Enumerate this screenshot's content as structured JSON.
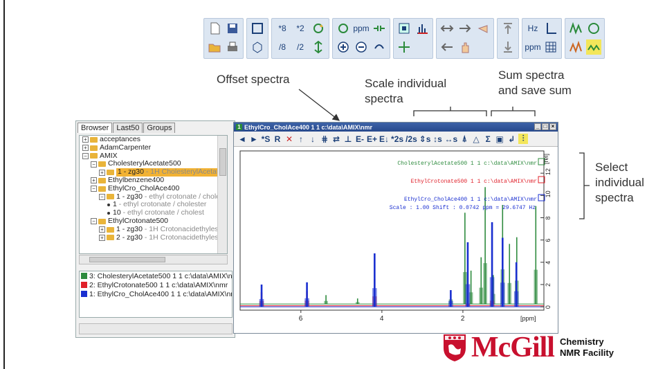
{
  "top_toolbar": {
    "groups": [
      {
        "buttons": [
          "new-file-icon",
          "open-folder-icon",
          "save-icon",
          "print-icon"
        ]
      },
      {
        "buttons": [
          "full-view-icon",
          "cube-icon"
        ]
      },
      {
        "buttons": [
          "*8",
          "/8",
          "*2",
          "/2",
          "rotate-icon",
          "center-icon"
        ]
      },
      {
        "buttons": [
          "cycle-icon",
          "zoom-in-icon",
          "ppm",
          "zoom-out-icon",
          "shift-icon",
          "refresh-icon"
        ]
      },
      {
        "buttons": [
          "window-icon",
          "expand-icon",
          "peak-pick-icon"
        ]
      },
      {
        "buttons": [
          "left-right-icon",
          "left-icon",
          "right-icon",
          "hand-icon",
          "hand2-icon"
        ]
      },
      {
        "buttons": [
          "top-icon",
          "down-icon"
        ]
      },
      {
        "buttons": [
          "Hz",
          "ppm",
          "axis-icon",
          "grid-icon"
        ]
      },
      {
        "buttons": [
          "multi-icon",
          "overlay-icon",
          "cross-icon",
          "stack-icon"
        ]
      }
    ]
  },
  "annotations": {
    "offset": "Offset spectra",
    "scale_line1": "Scale individual",
    "scale_line2": "spectra",
    "sum_line1": "Sum spectra",
    "sum_line2": "and save sum",
    "select_line1": "Select",
    "select_line2": "individual",
    "select_line3": "spectra"
  },
  "left_panel": {
    "tabs": [
      "Browser",
      "Last50",
      "Groups"
    ],
    "tree": [
      {
        "level": 0,
        "type": "folder",
        "label": "acceptances"
      },
      {
        "level": 0,
        "type": "folder",
        "label": "AdamCarpenter"
      },
      {
        "level": 0,
        "type": "folder",
        "label": "AMIX",
        "expanded": true
      },
      {
        "level": 1,
        "type": "folder",
        "label": "CholesterylAcetate500",
        "expanded": true
      },
      {
        "level": 2,
        "type": "folder",
        "label": "1 - zg30",
        "detail": " - 1H CholesterylAcetat",
        "selected": true
      },
      {
        "level": 1,
        "type": "folder",
        "label": "Ethylbenzene400"
      },
      {
        "level": 1,
        "type": "folder",
        "label": "EthylCro_CholAce400",
        "expanded": true
      },
      {
        "level": 2,
        "type": "folder",
        "label": "1 - zg30",
        "detail": " - ethyl crotonate / chole",
        "expanded": true
      },
      {
        "level": 3,
        "type": "dot",
        "label": "1",
        "detail": " - ethyl crotonate / cholester"
      },
      {
        "level": 3,
        "type": "dot",
        "label": "10",
        "detail": " - ethyl crotonate / cholest"
      },
      {
        "level": 1,
        "type": "folder",
        "label": "EthylCrotonate500",
        "expanded": true
      },
      {
        "level": 2,
        "type": "folder",
        "label": "1 - zg30",
        "detail": " - 1H Crotonacidethylest"
      },
      {
        "level": 2,
        "type": "folder",
        "label": "2 - zg30",
        "detail": " - 1H Crotonacidethylest"
      }
    ],
    "spectra_list": [
      {
        "label": "3: CholesterylAcetate500  1  1  c:\\data\\AMIX\\nm",
        "color": "#2e8b3e"
      },
      {
        "label": "2: EthylCrotonate500  1  1  c:\\data\\AMIX\\nmr",
        "color": "#e0202a"
      },
      {
        "label": "1: EthylCro_CholAce400  1  1  c:\\data\\AMIX\\nmr",
        "color": "#1a2fd0"
      }
    ]
  },
  "spectrum_window": {
    "title": "EthylCro_CholAce400  1  1  c:\\data\\AMIX\\nmr",
    "app_icon_label": "1",
    "toolbar": [
      "◄",
      "►",
      "*S",
      "R",
      "✕",
      "↑",
      "↓",
      "⋕",
      "⇄",
      "⊥",
      "E-",
      "E+",
      "E↓",
      "*2s",
      "/2s",
      "⇕s",
      "↕s",
      "↔s",
      "⍋",
      "△",
      "Σ",
      "▣",
      "↲",
      "⫶"
    ],
    "legends": [
      {
        "text": "CholesterylAcetate500  1  1  c:\\data\\AMIX\\nmr",
        "color": "#2e8b3e"
      },
      {
        "text": "EthylCrotonate500  1  1  c:\\data\\AMIX\\nmr",
        "color": "#e0202a"
      },
      {
        "text": "EthylCro_CholAce400  1  1  c:\\data\\AMIX\\nmr",
        "color": "#1a2fd0"
      }
    ],
    "scale_info": "Scale : 1.00 Shift : 0.0742 ppm = 29.6747 Hz",
    "x_unit": "[ppm]",
    "y_unit": "[rel]"
  },
  "chart_data": {
    "type": "line",
    "x_ticks": [
      "6",
      "4",
      "2"
    ],
    "y_ticks": [
      "0",
      "2",
      "4",
      "6",
      "8",
      "10",
      "12"
    ],
    "xlabel": "[ppm]",
    "ylabel": "[rel]",
    "xlim": [
      7.5,
      0
    ],
    "ylim": [
      -0.3,
      14
    ],
    "series": [
      {
        "name": "CholesterylAcetate500",
        "color": "#2e8b3e",
        "peaks": [
          [
            1.95,
            8.2
          ],
          [
            1.45,
            10.5
          ],
          [
            1.02,
            8.9
          ],
          [
            0.67,
            6.0
          ],
          [
            2.3,
            1.2
          ],
          [
            1.8,
            3.0
          ],
          [
            1.55,
            4.2
          ],
          [
            1.25,
            2.6
          ],
          [
            0.85,
            5.4
          ],
          [
            5.38,
            0.8
          ],
          [
            4.6,
            0.5
          ],
          [
            0.2,
            8.8
          ]
        ]
      },
      {
        "name": "EthylCrotonate500",
        "color": "#e0202a",
        "peaks": [
          [
            6.97,
            1.2
          ],
          [
            5.85,
            1.3
          ],
          [
            4.18,
            2.4
          ],
          [
            1.88,
            0.5
          ],
          [
            1.28,
            1.3
          ]
        ]
      },
      {
        "name": "EthylCro_CholAce400",
        "color": "#1a2fd0",
        "peaks": [
          [
            6.97,
            2.0
          ],
          [
            5.85,
            2.2
          ],
          [
            4.18,
            4.8
          ],
          [
            1.88,
            5.8
          ],
          [
            1.28,
            7.6
          ],
          [
            1.02,
            6.2
          ],
          [
            2.3,
            1.5
          ],
          [
            0.68,
            4.0
          ]
        ]
      }
    ]
  },
  "logo": {
    "name": "McGill",
    "sub1": "Chemistry",
    "sub2": "NMR Facility"
  }
}
